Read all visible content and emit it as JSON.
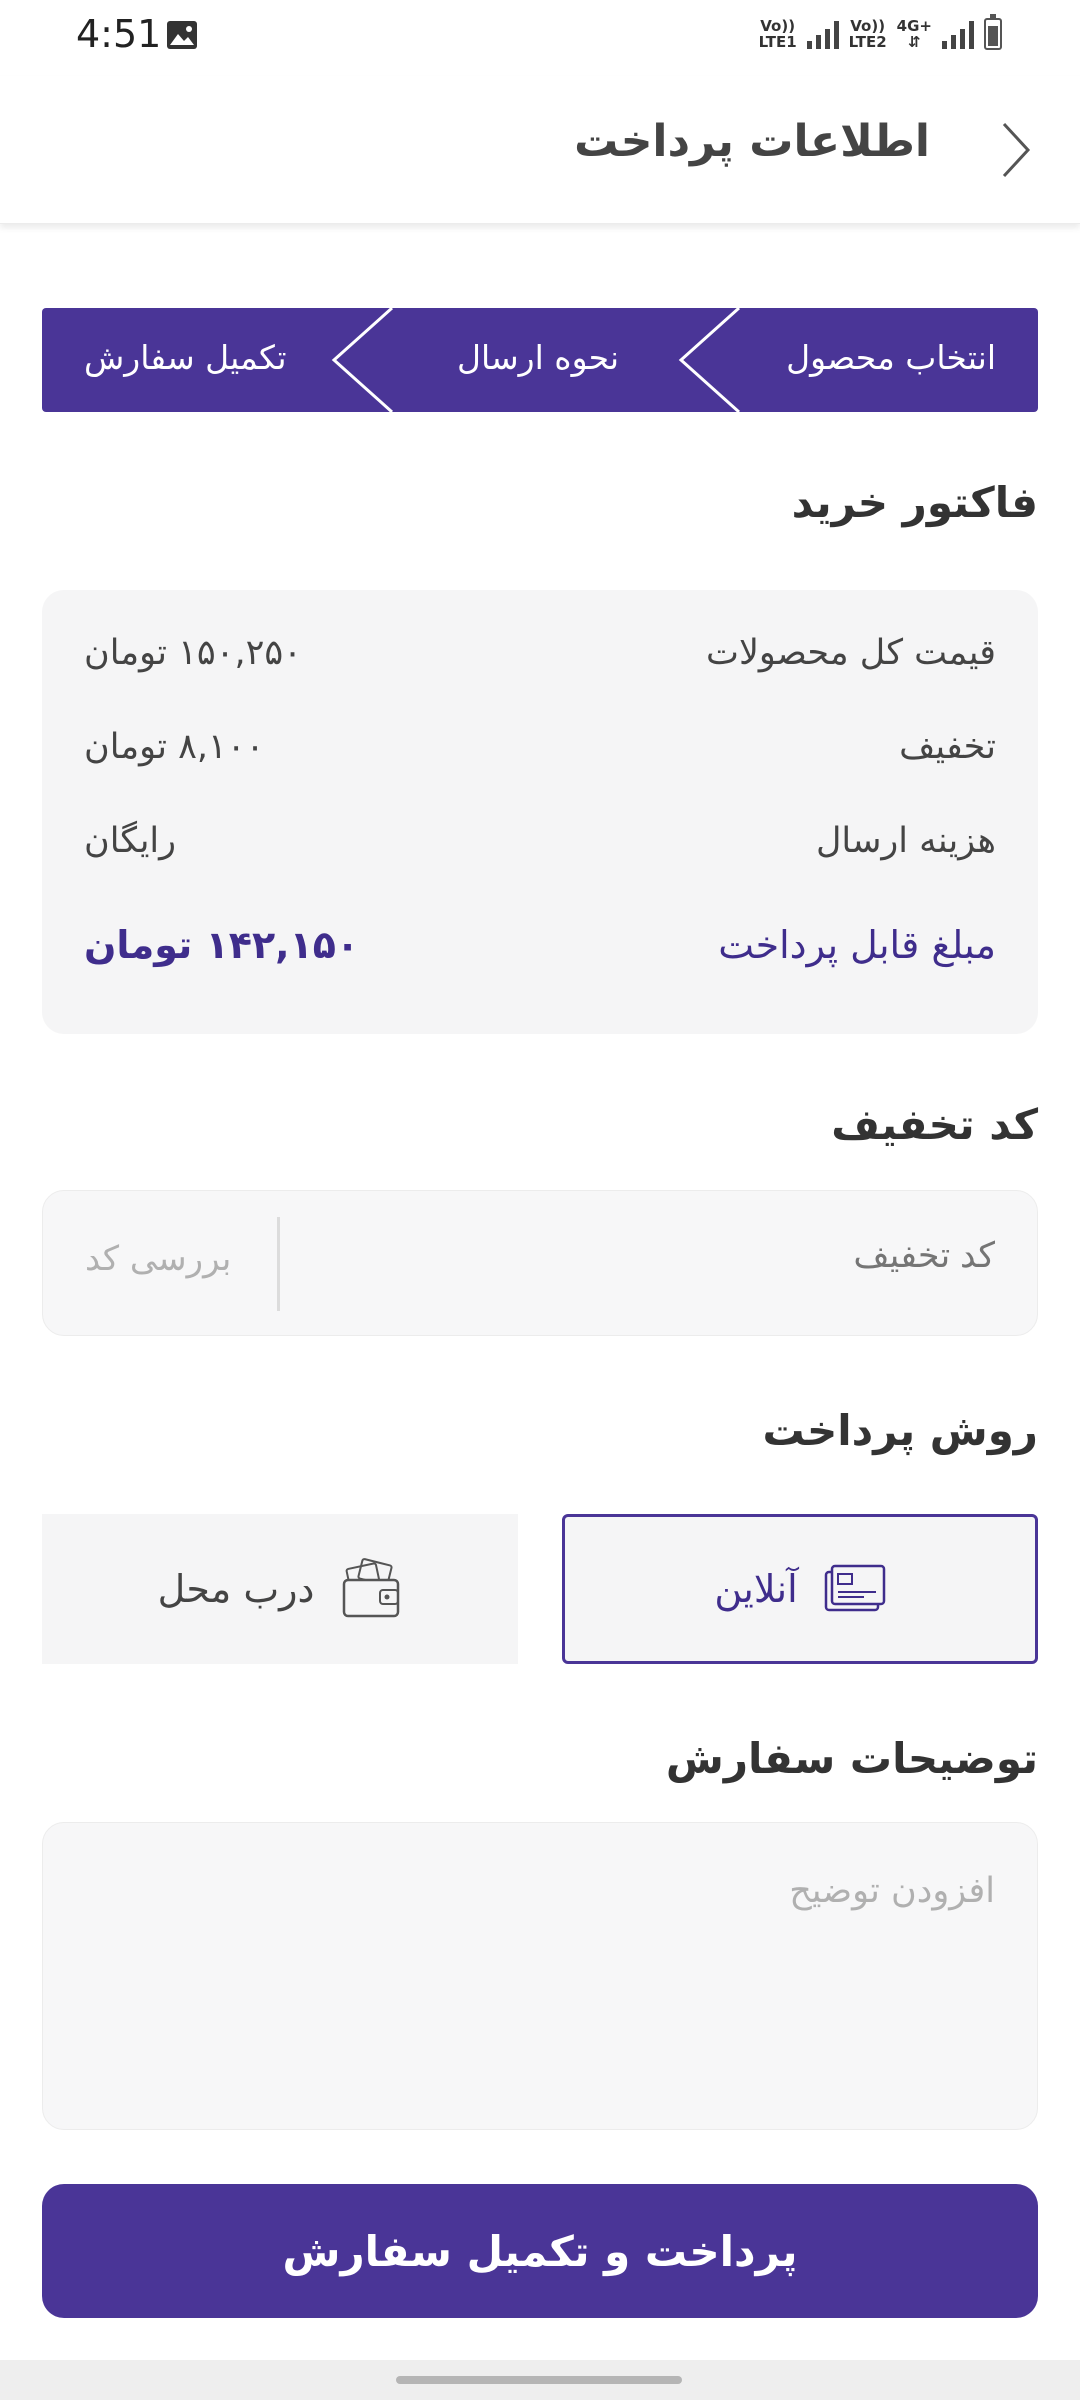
{
  "status_bar": {
    "time": "4:51",
    "net1_top": "Vo))",
    "net1_bottom": "LTE1",
    "net2_top": "Vo))",
    "net2_bottom": "LTE2",
    "net_type": "4G+"
  },
  "header": {
    "title": "اطلاعات پرداخت"
  },
  "stepper": {
    "steps": [
      {
        "label": "انتخاب محصول"
      },
      {
        "label": "نحوه ارسال"
      },
      {
        "label": "تکمیل سفارش"
      }
    ]
  },
  "invoice": {
    "title": "فاکتور خرید",
    "rows": [
      {
        "label": "قیمت کل محصولات",
        "value": "۱۵۰,۲۵۰ تومان"
      },
      {
        "label": "تخفیف",
        "value": "۸,۱۰۰ تومان"
      },
      {
        "label": "هزینه ارسال",
        "value": "رایگان"
      },
      {
        "label": "مبلغ قابل پرداخت",
        "value": "۱۴۲,۱۵۰ تومان"
      }
    ]
  },
  "discount": {
    "title": "کد تخفیف",
    "placeholder": "کد تخفیف",
    "check_label": "بررسی کد"
  },
  "payment": {
    "title": "روش پرداخت",
    "options": [
      {
        "label": "آنلاین",
        "icon": "card-icon",
        "selected": true
      },
      {
        "label": "درب محل",
        "icon": "wallet-icon",
        "selected": false
      }
    ]
  },
  "notes": {
    "title": "توضیحات سفارش",
    "placeholder": "افزودن توضیح"
  },
  "submit": {
    "label": "پرداخت و تکمیل سفارش"
  },
  "colors": {
    "accent": "#4a3597",
    "accent_text": "#3f2d8c",
    "card_bg": "#f5f5f6"
  }
}
